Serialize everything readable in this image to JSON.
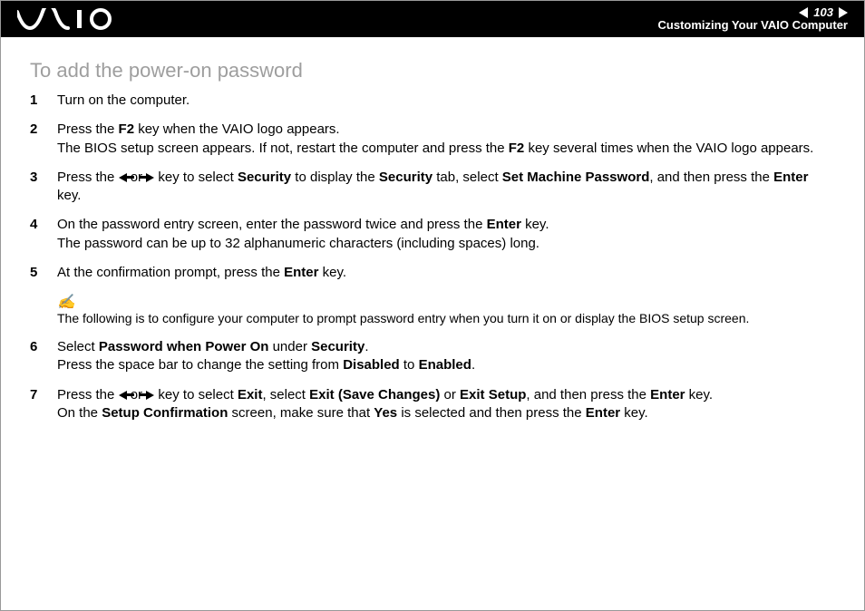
{
  "header": {
    "page_number": "103",
    "section": "Customizing Your VAIO Computer"
  },
  "title": "To add the power-on password",
  "steps": [
    {
      "n": "1",
      "segs": [
        {
          "t": "Turn on the computer."
        }
      ]
    },
    {
      "n": "2",
      "segs": [
        {
          "t": "Press the "
        },
        {
          "t": "F2",
          "b": true
        },
        {
          "t": " key when the VAIO logo appears."
        },
        {
          "br": true
        },
        {
          "t": "The BIOS setup screen appears. If not, restart the computer and press the "
        },
        {
          "t": "F2",
          "b": true
        },
        {
          "t": " key several times when the VAIO logo appears."
        }
      ]
    },
    {
      "n": "3",
      "segs": [
        {
          "t": "Press the "
        },
        {
          "arrow": "l"
        },
        {
          "t": " or "
        },
        {
          "arrow": "r"
        },
        {
          "t": " key to select "
        },
        {
          "t": "Security",
          "b": true
        },
        {
          "t": " to display the "
        },
        {
          "t": "Security",
          "b": true
        },
        {
          "t": " tab, select "
        },
        {
          "t": "Set Machine Password",
          "b": true
        },
        {
          "t": ", and then press the "
        },
        {
          "t": "Enter",
          "b": true
        },
        {
          "t": " key."
        }
      ]
    },
    {
      "n": "4",
      "segs": [
        {
          "t": "On the password entry screen, enter the password twice and press the "
        },
        {
          "t": "Enter",
          "b": true
        },
        {
          "t": " key."
        },
        {
          "br": true
        },
        {
          "t": "The password can be up to 32 alphanumeric characters (including spaces) long."
        }
      ]
    },
    {
      "n": "5",
      "segs": [
        {
          "t": "At the confirmation prompt, press the "
        },
        {
          "t": "Enter",
          "b": true
        },
        {
          "t": " key."
        }
      ]
    }
  ],
  "note": {
    "icon": "✍",
    "text": "The following is to configure your computer to prompt password entry when you turn it on or display the BIOS setup screen."
  },
  "steps2": [
    {
      "n": "6",
      "segs": [
        {
          "t": "Select "
        },
        {
          "t": "Password when Power On",
          "b": true
        },
        {
          "t": " under "
        },
        {
          "t": "Security",
          "b": true
        },
        {
          "t": "."
        },
        {
          "br": true
        },
        {
          "t": "Press the space bar to change the setting from "
        },
        {
          "t": "Disabled",
          "b": true
        },
        {
          "t": " to "
        },
        {
          "t": "Enabled",
          "b": true
        },
        {
          "t": "."
        }
      ]
    },
    {
      "n": "7",
      "segs": [
        {
          "t": "Press the "
        },
        {
          "arrow": "l"
        },
        {
          "t": " or "
        },
        {
          "arrow": "r"
        },
        {
          "t": " key to select "
        },
        {
          "t": "Exit",
          "b": true
        },
        {
          "t": ", select "
        },
        {
          "t": "Exit (Save Changes)",
          "b": true
        },
        {
          "t": " or "
        },
        {
          "t": "Exit Setup",
          "b": true
        },
        {
          "t": ", and then press the "
        },
        {
          "t": "Enter",
          "b": true
        },
        {
          "t": " key."
        },
        {
          "br": true
        },
        {
          "t": "On the "
        },
        {
          "t": "Setup Confirmation",
          "b": true
        },
        {
          "t": " screen, make sure that "
        },
        {
          "t": "Yes",
          "b": true
        },
        {
          "t": " is selected and then press the "
        },
        {
          "t": "Enter",
          "b": true
        },
        {
          "t": " key."
        }
      ]
    }
  ]
}
